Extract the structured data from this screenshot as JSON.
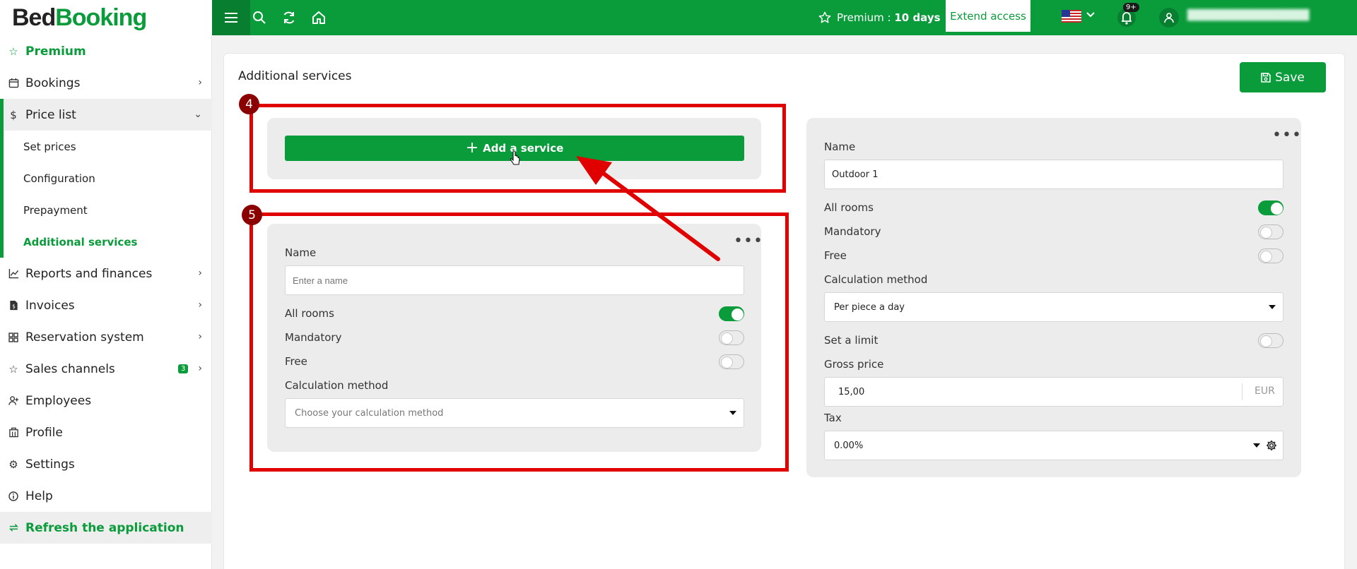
{
  "app": {
    "logo_part1": "Bed",
    "logo_part2": "Booking"
  },
  "topbar": {
    "premium_label": "Premium : ",
    "premium_days": "10 days",
    "extend_label": "Extend access",
    "notifications_badge": "9+",
    "icons": [
      "menu-icon",
      "search-icon",
      "refresh-icon",
      "home-icon",
      "star-icon",
      "us-flag-icon",
      "bell-icon",
      "user-icon"
    ]
  },
  "sidebar": {
    "items": [
      {
        "label": "Premium",
        "icon": "star-icon"
      },
      {
        "label": "Bookings",
        "icon": "calendar-icon"
      },
      {
        "label": "Price list",
        "icon": "dollar-icon"
      },
      {
        "label": "Set prices"
      },
      {
        "label": "Configuration"
      },
      {
        "label": "Prepayment"
      },
      {
        "label": "Additional services"
      },
      {
        "label": "Reports and finances",
        "icon": "chart-icon"
      },
      {
        "label": "Invoices",
        "icon": "invoice-icon"
      },
      {
        "label": "Reservation system",
        "icon": "grid-icon"
      },
      {
        "label": "Sales channels",
        "icon": "star-icon",
        "badge": "3"
      },
      {
        "label": "Employees",
        "icon": "user-add-icon"
      },
      {
        "label": "Profile",
        "icon": "building-icon"
      },
      {
        "label": "Settings",
        "icon": "gear-icon"
      },
      {
        "label": "Help",
        "icon": "info-icon"
      },
      {
        "label": "Refresh the application",
        "icon": "refresh-icon"
      }
    ]
  },
  "page": {
    "title": "Additional services",
    "save_label": "Save",
    "add_service_label": "Add a service"
  },
  "new_service": {
    "name_label": "Name",
    "name_placeholder": "Enter a name",
    "all_rooms_label": "All rooms",
    "all_rooms_on": true,
    "mandatory_label": "Mandatory",
    "mandatory_on": false,
    "free_label": "Free",
    "free_on": false,
    "calc_label": "Calculation method",
    "calc_placeholder": "Choose your calculation method"
  },
  "existing_service": {
    "name_label": "Name",
    "name_value": "Outdoor 1",
    "all_rooms_label": "All rooms",
    "all_rooms_on": true,
    "mandatory_label": "Mandatory",
    "mandatory_on": false,
    "free_label": "Free",
    "free_on": false,
    "calc_label": "Calculation method",
    "calc_value": "Per piece a day",
    "limit_label": "Set a limit",
    "limit_on": false,
    "gross_label": "Gross price",
    "gross_value": "15,00",
    "currency": "EUR",
    "tax_label": "Tax",
    "tax_value": "0.00%"
  },
  "annotations": {
    "marker_4": "4",
    "marker_5": "5",
    "color": "#e00000"
  },
  "colors": {
    "brand": "#0a9b3a",
    "annotation": "#e00000"
  }
}
